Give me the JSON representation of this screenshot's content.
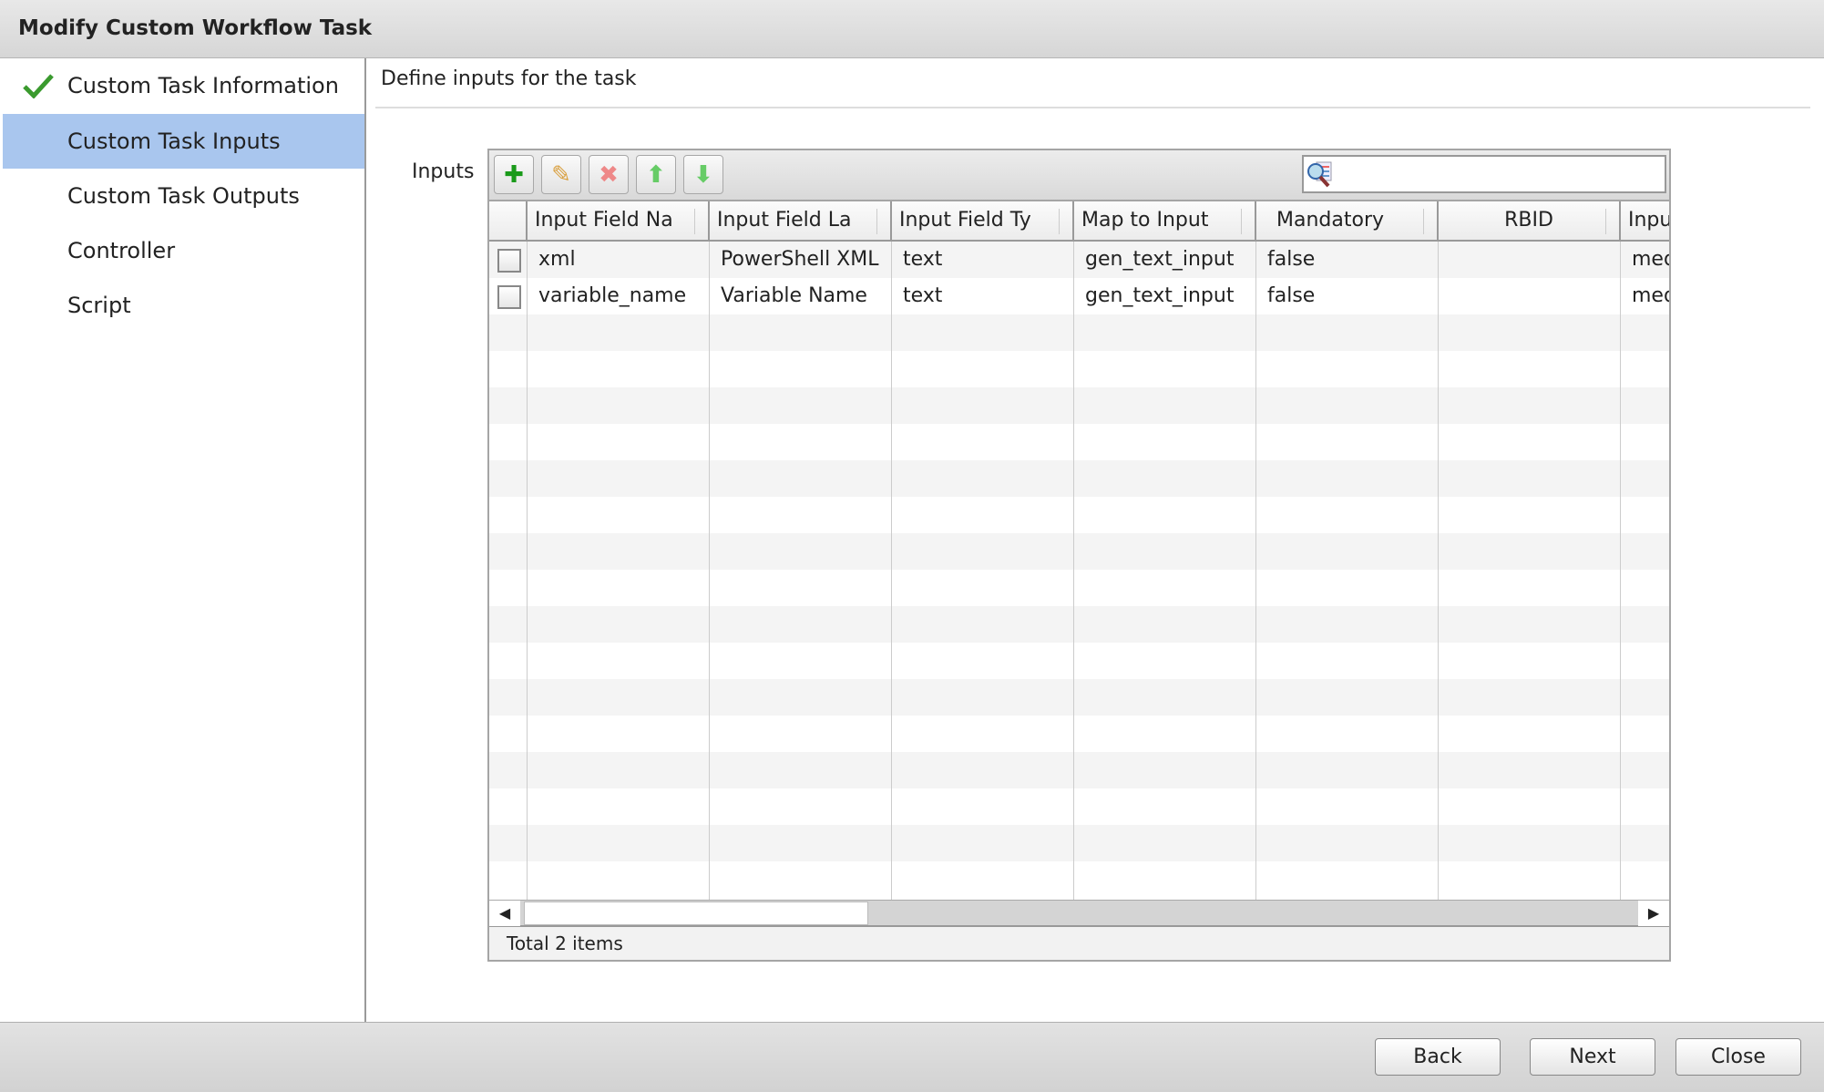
{
  "window": {
    "title": "Modify Custom Workflow Task"
  },
  "sidebar": {
    "items": [
      {
        "label": "Custom Task Information",
        "completed": true,
        "icon": "checkmark-icon"
      },
      {
        "label": "Custom Task Inputs",
        "selected": true
      },
      {
        "label": "Custom Task Outputs"
      },
      {
        "label": "Controller"
      },
      {
        "label": "Script"
      }
    ]
  },
  "main": {
    "heading": "Define inputs for the task",
    "inputs_label": "Inputs"
  },
  "toolbar": {
    "buttons": [
      "add-icon",
      "edit-icon",
      "delete-icon",
      "move-up-icon",
      "move-down-icon"
    ],
    "search_value": "",
    "search_icon": "search-filter-icon"
  },
  "table": {
    "columns": [
      "Input Field Na",
      "Input Field La",
      "Input Field Ty",
      "Map to Input ",
      "Mandatory",
      "RBID",
      "Inpu"
    ],
    "rows": [
      [
        "xml",
        "PowerShell XML ",
        "text",
        "gen_text_input",
        "false",
        "",
        "med"
      ],
      [
        "variable_name",
        "Variable Name",
        "text",
        "gen_text_input",
        "false",
        "",
        "med"
      ]
    ],
    "status": "Total 2 items"
  },
  "buttons": {
    "back": "Back",
    "next": "Next",
    "close": "Close"
  },
  "colors": {
    "selected": "#a9c6ee",
    "check": "#3a9a2e"
  }
}
